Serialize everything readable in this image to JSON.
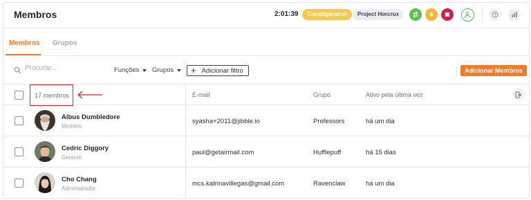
{
  "header": {
    "title": "Membros",
    "timer": "2:01:39",
    "activity": "Transfiguration",
    "project": "Project Horcrux"
  },
  "tabs": [
    {
      "label": "Membros",
      "active": true
    },
    {
      "label": "Grupos",
      "active": false
    }
  ],
  "toolbar": {
    "search_placeholder": "Procurar...",
    "filter_functions": "Funções",
    "filter_groups": "Grupos",
    "add_filter": "Adicionar filtro",
    "add_members": "Adicionar Membros"
  },
  "table": {
    "count": "17 membros",
    "columns": [
      "E-mail",
      "Grupo",
      "Ativo pela última vez"
    ],
    "rows": [
      {
        "name": "Albus Dumbledore",
        "role": "Membro",
        "email": "syasha+2011@jibble.io",
        "group": "Professors",
        "last_active": "há um dia"
      },
      {
        "name": "Cedric Diggory",
        "role": "Gerente",
        "email": "paul@getairmail.com",
        "group": "Hufflepuff",
        "last_active": "há 15 dias"
      },
      {
        "name": "Cho Chang",
        "role": "Administrador",
        "email": "mcs.katrinavillegas@gmail.com",
        "group": "Ravenclaw",
        "last_active": "há um dia"
      }
    ]
  },
  "colors": {
    "accent": "#f47a27",
    "highlight": "#d8222a",
    "activity_pill": "#f6c94c",
    "green": "#5fbf4f",
    "yellow": "#f7b630",
    "red": "#d81e4a"
  }
}
